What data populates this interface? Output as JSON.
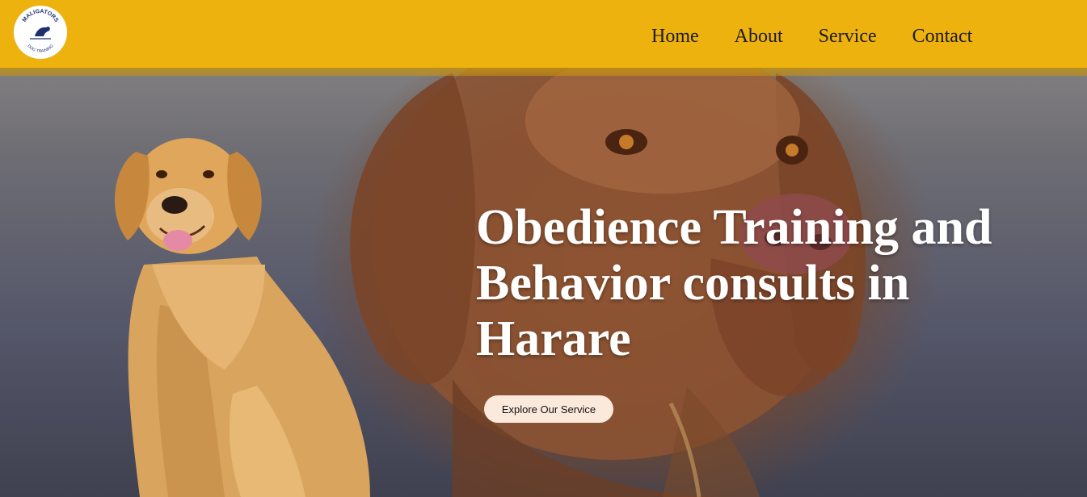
{
  "brand": {
    "logo_top_text": "MALIGATORS",
    "logo_bottom_text": "DOG TRAINING"
  },
  "nav": {
    "items": [
      {
        "label": "Home"
      },
      {
        "label": "About"
      },
      {
        "label": "Service"
      },
      {
        "label": "Contact"
      }
    ]
  },
  "hero": {
    "title": "Obedience Training and Behavior consults in Harare",
    "cta_label": "Explore Our Service"
  },
  "colors": {
    "navbar": "#eeb20e",
    "title_text": "#ffffff",
    "cta_background": "#fbeadc"
  }
}
